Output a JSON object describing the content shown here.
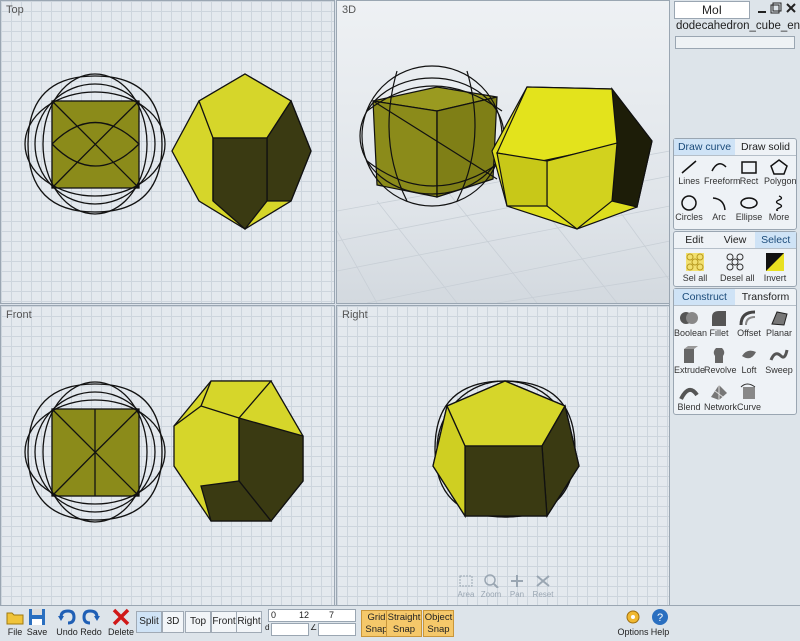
{
  "viewports": {
    "top": {
      "label": "Top"
    },
    "persp": {
      "label": "3D"
    },
    "front": {
      "label": "Front"
    },
    "right": {
      "label": "Right"
    }
  },
  "nav_controls": [
    "Area",
    "Zoom",
    "Pan",
    "Reset"
  ],
  "panel": {
    "app_title": "MoI",
    "file_name": "dodecahedron_cube_en...",
    "draw_tabs": [
      "Draw curve",
      "Draw solid"
    ],
    "draw_tools": [
      "Lines",
      "Freeform",
      "Rect",
      "Polygon",
      "Circles",
      "Arc",
      "Ellipse",
      "More"
    ],
    "edit_tabs": [
      "Edit",
      "View",
      "Select"
    ],
    "select_tools": [
      "Sel all",
      "Desel all",
      "Invert"
    ],
    "construct_tabs": [
      "Construct",
      "Transform"
    ],
    "construct_tools": [
      "Boolean",
      "Fillet",
      "Offset",
      "Planar",
      "Extrude",
      "Revolve",
      "Loft",
      "Sweep",
      "Blend",
      "Network",
      "Curve"
    ]
  },
  "toolbar": {
    "file": "File",
    "save": "Save",
    "undo": "Undo",
    "redo": "Redo",
    "delete": "Delete",
    "views": [
      "Split",
      "3D",
      "Top",
      "Front",
      "Right"
    ],
    "coords": {
      "x": "0",
      "y": "12",
      "z": "7",
      "d": "d",
      "angle": "∠"
    },
    "snaps": {
      "grid": [
        "Grid",
        "Snap"
      ],
      "straight": [
        "Straight",
        "Snap"
      ],
      "object": [
        "Object",
        "Snap"
      ]
    },
    "options": "Options",
    "help": "Help"
  },
  "colors": {
    "accent": "#cfe3f6",
    "face_light": "#d6d62a",
    "face_dark": "#3a3a12",
    "cube": "#8b8b1a",
    "snap": "#f5c86a"
  }
}
